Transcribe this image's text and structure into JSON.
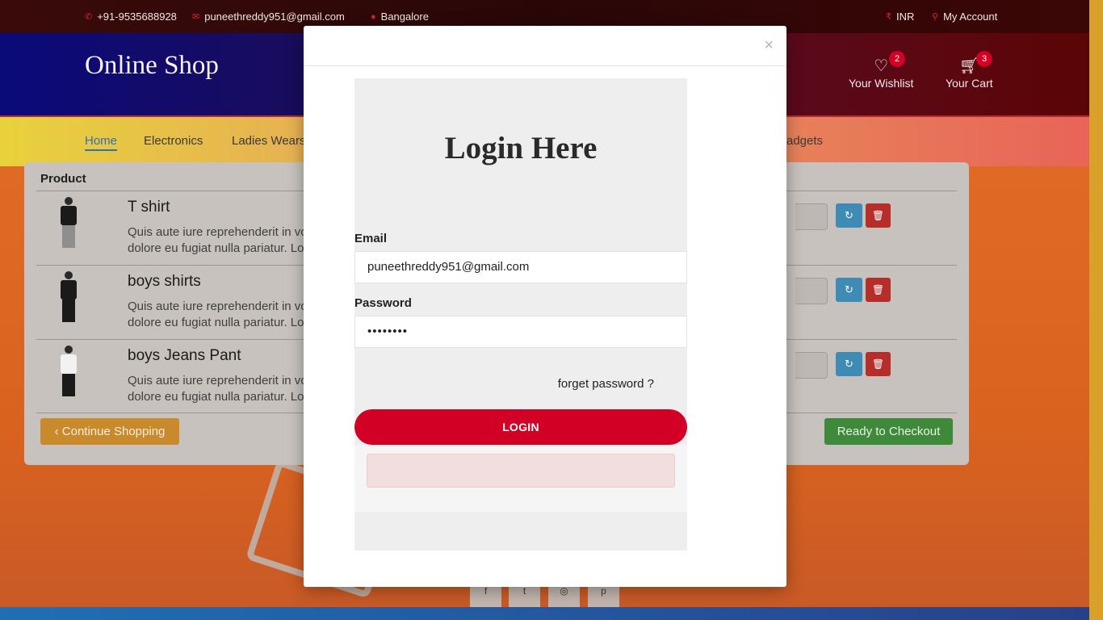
{
  "topbar": {
    "phone": "+91-9535688928",
    "email": "puneethreddy951@gmail.com",
    "location": "Bangalore",
    "currency": "INR",
    "account": "My Account"
  },
  "header": {
    "logo": "Online Shop",
    "wishlist_label": "Your Wishlist",
    "wishlist_count": "2",
    "cart_label": "Your Cart",
    "cart_count": "3"
  },
  "nav": {
    "items": [
      "Home",
      "Electronics",
      "Ladies Wears",
      "adgets"
    ],
    "active": "Home"
  },
  "cart": {
    "column_product": "Product",
    "rows": [
      {
        "name": "T shirt",
        "desc_line1": "Quis aute iure reprehenderit in vo",
        "desc_line2": "dolore eu fugiat nulla pariatur. Lo"
      },
      {
        "name": "boys shirts",
        "desc_line1": "Quis aute iure reprehenderit in vo",
        "desc_line2": "dolore eu fugiat nulla pariatur. Lo"
      },
      {
        "name": "boys Jeans Pant",
        "desc_line1": "Quis aute iure reprehenderit in vo",
        "desc_line2": "dolore eu fugiat nulla pariatur. Lo"
      }
    ],
    "continue_label": "Continue Shopping",
    "checkout_label": "Ready to Checkout"
  },
  "modal": {
    "close": "×",
    "title": "Login Here",
    "email_label": "Email",
    "email_value": "puneethreddy951@gmail.com",
    "password_label": "Password",
    "password_value": "••••••••",
    "forget_label": "forget password ?",
    "login_label": "LOGIN"
  },
  "icons": {
    "phone": "phone-icon",
    "email": "envelope-icon",
    "location": "map-marker-icon",
    "currency": "rupee-icon",
    "account": "user-icon",
    "wishlist": "heart-icon",
    "cart": "cart-icon",
    "refresh": "refresh-icon",
    "trash": "trash-icon"
  },
  "colors": {
    "brand_red": "#d10024",
    "nav_active": "#2e72b8",
    "refresh_btn": "#3e8bb5",
    "trash_btn": "#b52e2a",
    "continue_btn": "#c98a2c",
    "checkout_btn": "#3f8a3a"
  }
}
